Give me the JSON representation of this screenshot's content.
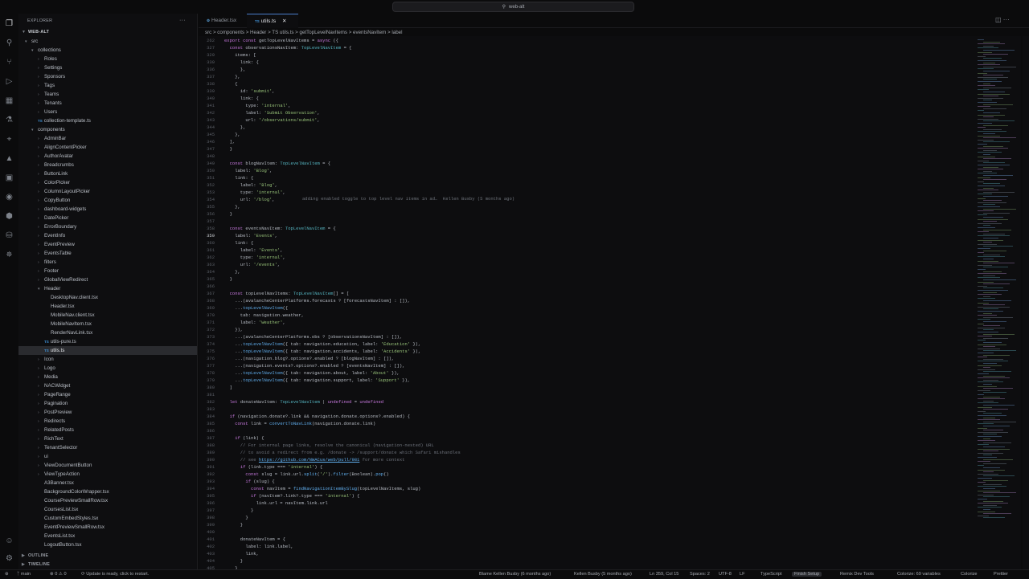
{
  "window": {
    "command_center": "web-alt"
  },
  "explorer": {
    "title": "EXPLORER",
    "root": "WEB-ALT",
    "outline": "OUTLINE",
    "timeline": "TIMELINE",
    "tree": [
      {
        "label": "src",
        "type": "folder",
        "open": true,
        "depth": 0
      },
      {
        "label": "collections",
        "type": "folder",
        "open": true,
        "depth": 1
      },
      {
        "label": "Roles",
        "type": "folder",
        "depth": 2
      },
      {
        "label": "Settings",
        "type": "folder",
        "depth": 2
      },
      {
        "label": "Sponsors",
        "type": "folder",
        "depth": 2
      },
      {
        "label": "Tags",
        "type": "folder",
        "depth": 2
      },
      {
        "label": "Teams",
        "type": "folder",
        "depth": 2
      },
      {
        "label": "Tenants",
        "type": "folder",
        "depth": 2
      },
      {
        "label": "Users",
        "type": "folder",
        "depth": 2
      },
      {
        "label": "collection-template.ts",
        "type": "ts",
        "depth": 2
      },
      {
        "label": "components",
        "type": "folder",
        "open": true,
        "depth": 1
      },
      {
        "label": "AdminBar",
        "type": "folder",
        "depth": 2
      },
      {
        "label": "AlignContentPicker",
        "type": "folder",
        "depth": 2
      },
      {
        "label": "AuthorAvatar",
        "type": "folder",
        "depth": 2
      },
      {
        "label": "Breadcrumbs",
        "type": "folder",
        "depth": 2
      },
      {
        "label": "ButtonLink",
        "type": "folder",
        "depth": 2
      },
      {
        "label": "ColorPicker",
        "type": "folder",
        "depth": 2
      },
      {
        "label": "ColumnLayoutPicker",
        "type": "folder",
        "depth": 2
      },
      {
        "label": "CopyButton",
        "type": "folder",
        "depth": 2
      },
      {
        "label": "dashboard-widgets",
        "type": "folder",
        "depth": 2
      },
      {
        "label": "DatePicker",
        "type": "folder",
        "depth": 2
      },
      {
        "label": "ErrorBoundary",
        "type": "folder",
        "depth": 2
      },
      {
        "label": "EventInfo",
        "type": "folder",
        "depth": 2
      },
      {
        "label": "EventPreview",
        "type": "folder",
        "depth": 2
      },
      {
        "label": "EventsTable",
        "type": "folder",
        "depth": 2
      },
      {
        "label": "filters",
        "type": "folder",
        "depth": 2
      },
      {
        "label": "Footer",
        "type": "folder",
        "depth": 2
      },
      {
        "label": "GlobalViewRedirect",
        "type": "folder",
        "depth": 2
      },
      {
        "label": "Header",
        "type": "folder",
        "open": true,
        "depth": 2
      },
      {
        "label": "DesktopNav.client.tsx",
        "type": "file",
        "depth": 3
      },
      {
        "label": "Header.tsx",
        "type": "file",
        "depth": 3
      },
      {
        "label": "MobileNav.client.tsx",
        "type": "file",
        "depth": 3
      },
      {
        "label": "MobileNavItem.tsx",
        "type": "file",
        "depth": 3
      },
      {
        "label": "RenderNavLink.tsx",
        "type": "file",
        "depth": 3
      },
      {
        "label": "utils-pure.ts",
        "type": "ts",
        "depth": 3
      },
      {
        "label": "utils.ts",
        "type": "ts",
        "depth": 3,
        "selected": true
      },
      {
        "label": "Icon",
        "type": "folder",
        "depth": 2
      },
      {
        "label": "Logo",
        "type": "folder",
        "depth": 2
      },
      {
        "label": "Media",
        "type": "folder",
        "depth": 2
      },
      {
        "label": "NACWidget",
        "type": "folder",
        "depth": 2
      },
      {
        "label": "PageRange",
        "type": "folder",
        "depth": 2
      },
      {
        "label": "Pagination",
        "type": "folder",
        "depth": 2
      },
      {
        "label": "PostPreview",
        "type": "folder",
        "depth": 2
      },
      {
        "label": "Redirects",
        "type": "folder",
        "depth": 2
      },
      {
        "label": "RelatedPosts",
        "type": "folder",
        "depth": 2
      },
      {
        "label": "RichText",
        "type": "folder",
        "depth": 2
      },
      {
        "label": "TenantSelector",
        "type": "folder",
        "depth": 2
      },
      {
        "label": "ui",
        "type": "folder",
        "depth": 2
      },
      {
        "label": "ViewDocumentButton",
        "type": "folder",
        "depth": 2
      },
      {
        "label": "ViewTypeAction",
        "type": "folder",
        "depth": 2
      },
      {
        "label": "A3Banner.tsx",
        "type": "file",
        "depth": 2
      },
      {
        "label": "BackgroundColorWrapper.tsx",
        "type": "file",
        "depth": 2
      },
      {
        "label": "CoursePreviewSmallRow.tsx",
        "type": "file",
        "depth": 2
      },
      {
        "label": "CoursesList.tsx",
        "type": "file",
        "depth": 2
      },
      {
        "label": "CustomEmbedStyles.tsx",
        "type": "file",
        "depth": 2
      },
      {
        "label": "EventPreviewSmallRow.tsx",
        "type": "file",
        "depth": 2
      },
      {
        "label": "EventsList.tsx",
        "type": "file",
        "depth": 2
      },
      {
        "label": "LogoutButton.tsx",
        "type": "file",
        "depth": 2
      }
    ]
  },
  "tabs": [
    {
      "label": "Header.tsx",
      "active": false
    },
    {
      "label": "utils.ts",
      "active": true
    }
  ],
  "breadcrumb": "src > components > Header > TS utils.ts > getTopLevelNavItems > eventsNavItem > label",
  "blame_inline": "adding enabled toggle to top level nav items in ad…  Kellen Busby (5 months ago)",
  "code": [
    [
      "262",
      "export const getTopLevelNavItems = async ({"
    ],
    [
      "327",
      "  const observationsNavItem: TopLevelNavItem = {"
    ],
    [
      "329",
      "    items: ["
    ],
    [
      "330",
      "      link: {"
    ],
    [
      "336",
      "      },"
    ],
    [
      "337",
      "    },"
    ],
    [
      "338",
      "    {"
    ],
    [
      "339",
      "      id: 'submit',"
    ],
    [
      "340",
      "      link: {"
    ],
    [
      "341",
      "        type: 'internal',"
    ],
    [
      "342",
      "        label: 'Submit Observation',"
    ],
    [
      "343",
      "        url: '/observations/submit',"
    ],
    [
      "344",
      "      },"
    ],
    [
      "345",
      "    },"
    ],
    [
      "346",
      "  ],"
    ],
    [
      "347",
      "  }"
    ],
    [
      "348",
      ""
    ],
    [
      "349",
      "  const blogNavItem: TopLevelNavItem = {"
    ],
    [
      "350",
      "    label: 'Blog',"
    ],
    [
      "351",
      "    link: {"
    ],
    [
      "352",
      "      label: 'Blog',"
    ],
    [
      "353",
      "      type: 'internal',"
    ],
    [
      "354",
      "      url: '/blog',"
    ],
    [
      "355",
      "    },"
    ],
    [
      "356",
      "  }"
    ],
    [
      "357",
      ""
    ],
    [
      "358",
      "  const eventsNavItem: TopLevelNavItem = {"
    ],
    [
      "359",
      "    label: 'Events',"
    ],
    [
      "360",
      "    link: {"
    ],
    [
      "361",
      "      label: 'Events',"
    ],
    [
      "362",
      "      type: 'internal',"
    ],
    [
      "363",
      "      url: '/events',"
    ],
    [
      "364",
      "    },"
    ],
    [
      "365",
      "  }"
    ],
    [
      "366",
      ""
    ],
    [
      "367",
      "  const topLevelNavItems: TopLevelNavItem[] = ["
    ],
    [
      "368",
      "    ...(avalancheCenterPlatforms.forecasts ? [forecastsNavItem] : []),"
    ],
    [
      "369",
      "    ...topLevelNavItem({"
    ],
    [
      "370",
      "      tab: navigation.weather,"
    ],
    [
      "371",
      "      label: 'Weather',"
    ],
    [
      "372",
      "    }),"
    ],
    [
      "373",
      "    ...(avalancheCenterPlatforms.obs ? [observationsNavItem] : []),"
    ],
    [
      "374",
      "    ...topLevelNavItem({ tab: navigation.education, label: 'Education' }),"
    ],
    [
      "375",
      "    ...topLevelNavItem({ tab: navigation.accidents, label: 'Accidents' }),"
    ],
    [
      "376",
      "    ...(navigation.blog?.options?.enabled ? [blogNavItem] : []),"
    ],
    [
      "377",
      "    ...(navigation.events?.options?.enabled ? [eventsNavItem] : []),"
    ],
    [
      "378",
      "    ...topLevelNavItem({ tab: navigation.about, label: 'About' }),"
    ],
    [
      "379",
      "    ...topLevelNavItem({ tab: navigation.support, label: 'Support' }),"
    ],
    [
      "380",
      "  ]"
    ],
    [
      "381",
      ""
    ],
    [
      "382",
      "  let donateNavItem: TopLevelNavItem | undefined = undefined"
    ],
    [
      "383",
      ""
    ],
    [
      "384",
      "  if (navigation.donate?.link && navigation.donate.options?.enabled) {"
    ],
    [
      "385",
      "    const link = convertToNavLink(navigation.donate.link)"
    ],
    [
      "386",
      ""
    ],
    [
      "387",
      "    if (link) {"
    ],
    [
      "388",
      "      // For internal page links, resolve the canonical (navigation-nested) URL"
    ],
    [
      "389",
      "      // to avoid a redirect from e.g. /donate -> /support/donate which Safari mishandles"
    ],
    [
      "390",
      "      // see https://github.com/NWACus/web/pull/981 for more context"
    ],
    [
      "391",
      "      if (link.type === 'internal') {"
    ],
    [
      "392",
      "        const slug = link.url.split('/').filter(Boolean).pop()"
    ],
    [
      "393",
      "        if (slug) {"
    ],
    [
      "394",
      "          const navItem = findNavigationItemBySlug(topLevelNavItems, slug)"
    ],
    [
      "395",
      "          if (navItem?.link?.type === 'internal') {"
    ],
    [
      "396",
      "            link.url = navItem.link.url"
    ],
    [
      "397",
      "          }"
    ],
    [
      "398",
      "        }"
    ],
    [
      "399",
      "      }"
    ],
    [
      "400",
      ""
    ],
    [
      "401",
      "      donateNavItem = {"
    ],
    [
      "402",
      "        label: link.label,"
    ],
    [
      "403",
      "        link,"
    ],
    [
      "404",
      "      }"
    ],
    [
      "405",
      "    }"
    ]
  ],
  "status": {
    "branch": "main",
    "problems": "0 ⚠ 0",
    "update": "Update is ready, click to restart.",
    "blame": "Blame Kellen Busby (6 months ago)",
    "blame2": "Kellen Busby (5 months ago)",
    "position": "Ln 359, Col 15",
    "spaces": "Spaces: 2",
    "encoding": "UTF-8",
    "eol": "LF",
    "language": "TypeScript",
    "finish": "Finish Setup",
    "remix": "Remix Dev Tools",
    "colorize": "Colorize: 69 variables",
    "colorize2": "Colorize",
    "prettier": "Prettier"
  },
  "icons": [
    "files-icon",
    "search-icon",
    "source-control-icon",
    "run-debug-icon",
    "extensions-icon",
    "testing-icon",
    "remote-icon",
    "deploy-icon",
    "docker-icon",
    "github-icon",
    "python-icon",
    "database-icon",
    "git-graph-icon",
    "account-icon",
    "settings-icon"
  ]
}
